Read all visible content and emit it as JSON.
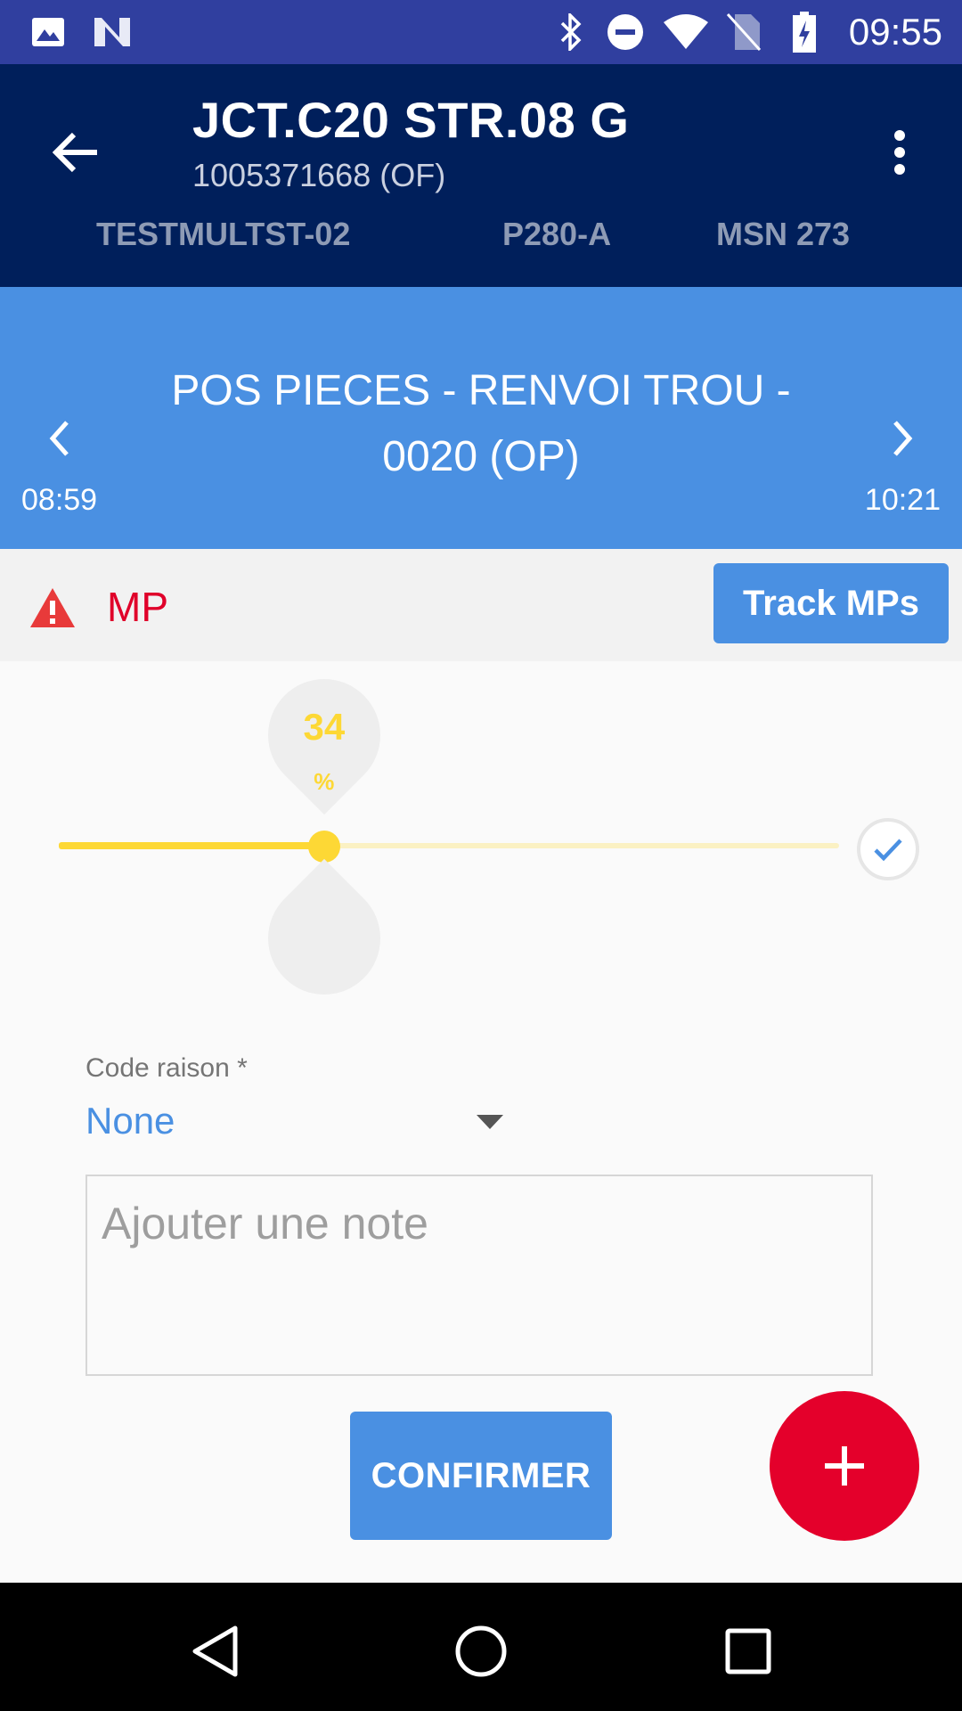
{
  "status_bar": {
    "time": "09:55",
    "icons": [
      "image-icon",
      "n-logo-icon",
      "bluetooth-icon",
      "do-not-disturb-icon",
      "wifi-icon",
      "no-sim-icon",
      "battery-charging-icon"
    ]
  },
  "app_bar": {
    "title": "JCT.C20 STR.08 G",
    "subtitle": "1005371668 (OF)",
    "tabs": [
      {
        "label": "TESTMULTST-02"
      },
      {
        "label": "P280-A"
      },
      {
        "label": "MSN 273"
      }
    ]
  },
  "operation": {
    "title_line1": "POS PIECES - RENVOI TROU -",
    "title_line2": "0020 (OP)",
    "start_time": "08:59",
    "end_time": "10:21"
  },
  "mp": {
    "label": "MP",
    "track_button": "Track MPs"
  },
  "progress": {
    "value": 34,
    "value_label": "34",
    "unit": "%"
  },
  "form": {
    "reason_label": "Code raison *",
    "reason_value": "None",
    "note_placeholder": "Ajouter une note",
    "confirm_label": "CONFIRMER"
  },
  "colors": {
    "status_bar": "#303f9f",
    "app_bar": "#001f5b",
    "accent_blue": "#4a90e2",
    "slider_yellow": "#fdd835",
    "alert_red": "#e4002b"
  }
}
